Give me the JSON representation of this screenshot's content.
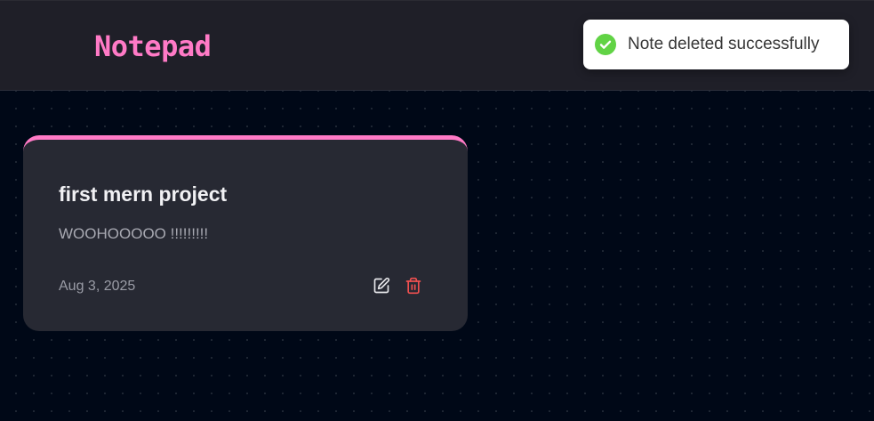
{
  "navbar": {
    "brand": "Notepad",
    "brand_color": "#ff7ac6"
  },
  "toast": {
    "message": "Note deleted successfully",
    "icon": "check-circle-icon",
    "icon_color": "#61d345"
  },
  "notes": [
    {
      "title": "first mern project",
      "content": "WOOHOOOOO !!!!!!!!!",
      "date": "Aug 3, 2025",
      "accent_color": "#ff7ac6",
      "actions": {
        "edit_icon": "edit-icon",
        "delete_icon": "trash-icon",
        "delete_color": "#f05050"
      }
    }
  ]
}
